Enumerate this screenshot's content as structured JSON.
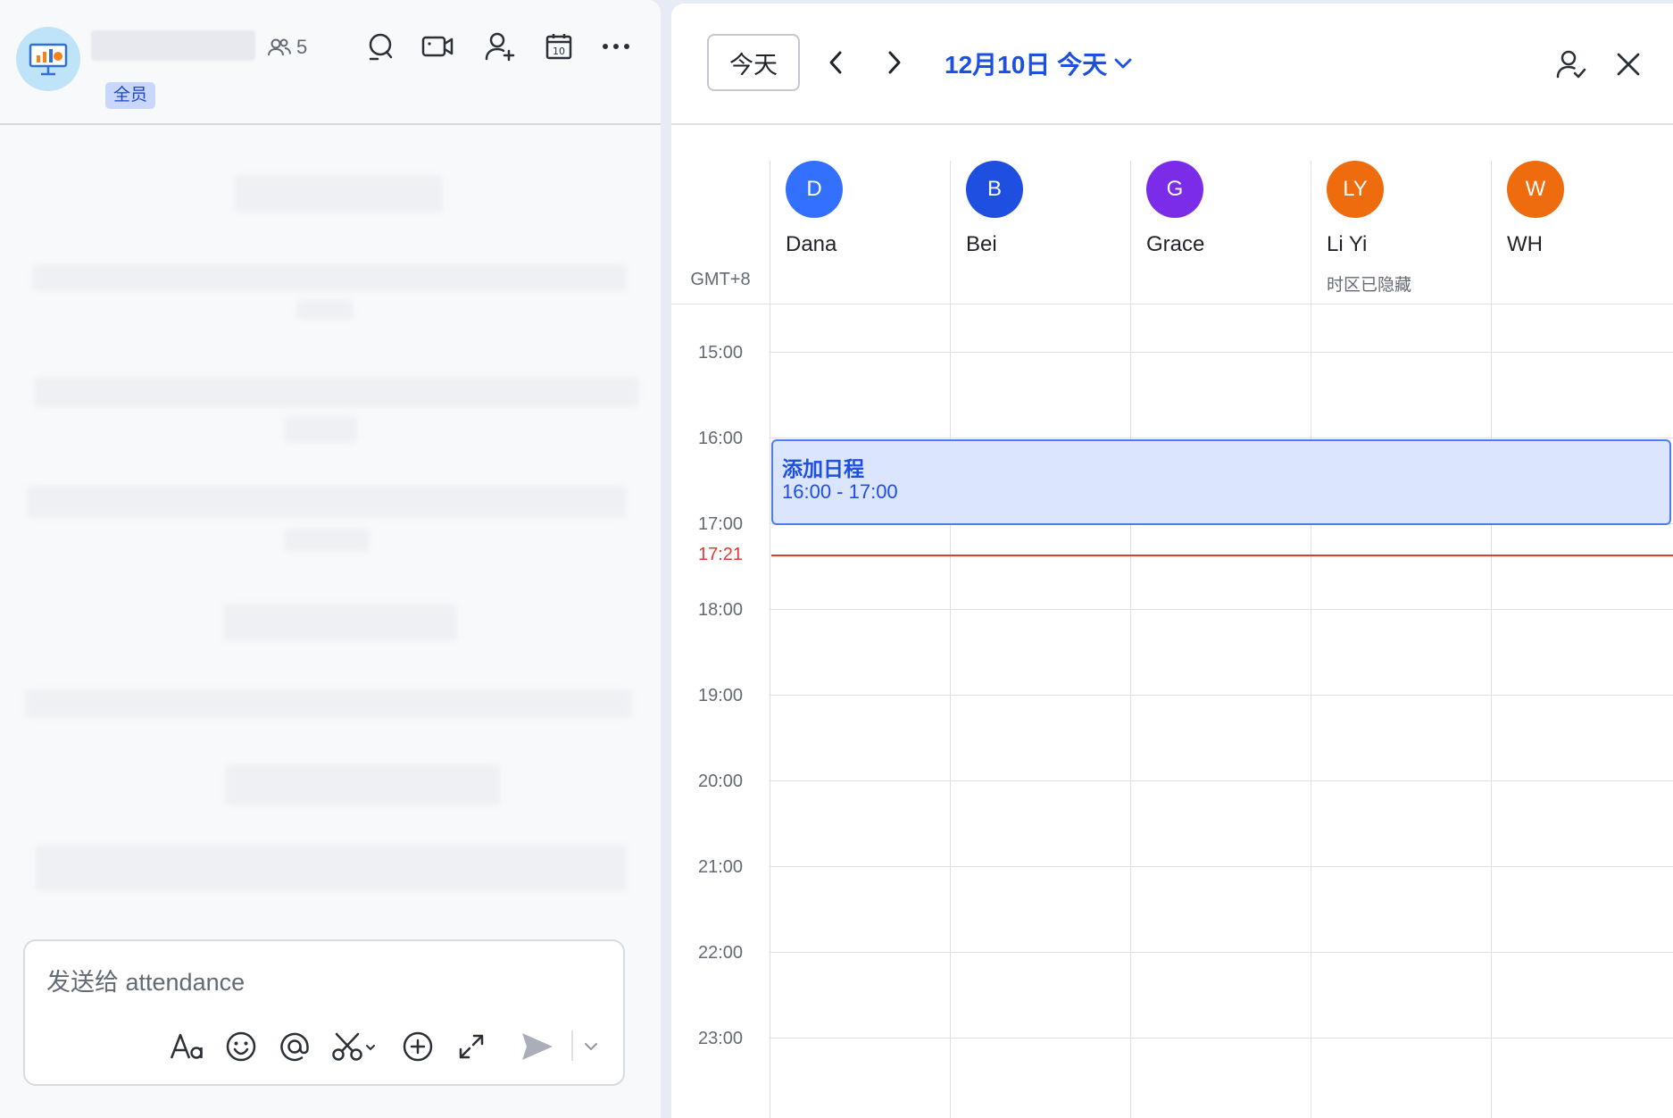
{
  "chat": {
    "member_count": "5",
    "tag": "全员",
    "composer_placeholder": "发送给 attendance"
  },
  "calendar": {
    "today_button": "今天",
    "date_title": "12月10日 今天",
    "timezone": "GMT+8",
    "people": [
      {
        "initials": "D",
        "name": "Dana",
        "color": "#3370ff",
        "note": ""
      },
      {
        "initials": "B",
        "name": "Bei",
        "color": "#1f4fe0",
        "note": ""
      },
      {
        "initials": "G",
        "name": "Grace",
        "color": "#7a2ce8",
        "note": ""
      },
      {
        "initials": "LY",
        "name": "Li Yi",
        "color": "#ee6b0e",
        "note": "时区已隐藏"
      },
      {
        "initials": "W",
        "name": "WH",
        "color": "#ee6b0e",
        "note": ""
      }
    ],
    "hours": [
      "15:00",
      "16:00",
      "17:00",
      "18:00",
      "19:00",
      "20:00",
      "21:00",
      "22:00",
      "23:00"
    ],
    "current_time": "17:21",
    "event": {
      "title": "添加日程",
      "time": "16:00 - 17:00"
    },
    "colors": {
      "accent": "#1d4fe0",
      "now_line": "#e33a32",
      "event_bg": "#dbe5fd"
    }
  }
}
